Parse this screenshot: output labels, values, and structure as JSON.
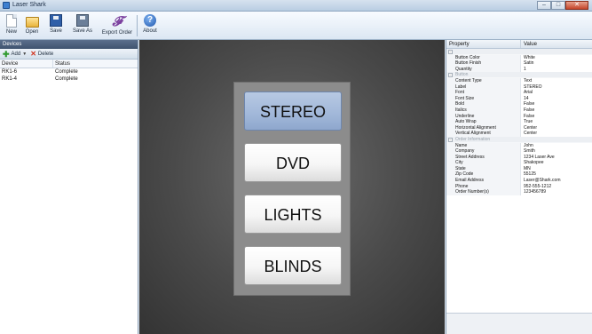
{
  "window": {
    "title": "Laser Shark",
    "controls": [
      "–",
      "□",
      "✕"
    ]
  },
  "toolbar": {
    "items": [
      {
        "label": "New",
        "icon": "new-document-icon"
      },
      {
        "label": "Open",
        "icon": "open-folder-icon"
      },
      {
        "label": "Save",
        "icon": "save-icon"
      },
      {
        "label": "Save As",
        "icon": "save-as-icon"
      },
      {
        "label": "Export Order",
        "icon": "export-order-icon"
      },
      {
        "label": "About",
        "icon": "about-icon"
      }
    ],
    "export_glyph": "𝓕",
    "about_glyph": "?"
  },
  "devices": {
    "header": "Devices",
    "add_label": "Add",
    "delete_label": "Delete",
    "columns": [
      "Device",
      "Status"
    ],
    "rows": [
      {
        "device": "RK1-6",
        "status": "Complete"
      },
      {
        "device": "RK1-4",
        "status": "Complete"
      }
    ]
  },
  "keypad": {
    "selected_index": 0,
    "buttons": [
      "STEREO",
      "DVD",
      "LIGHTS",
      "BLINDS"
    ]
  },
  "properties": {
    "columns": [
      "Property",
      "Value"
    ],
    "groups": [
      {
        "name": "",
        "rows": [
          {
            "p": "Button Color",
            "v": "White"
          },
          {
            "p": "Button Finish",
            "v": "Satin"
          },
          {
            "p": "Quantity",
            "v": "1"
          }
        ]
      },
      {
        "name": "Button",
        "rows": [
          {
            "p": "Content Type",
            "v": "Text"
          },
          {
            "p": "Label",
            "v": "STEREO"
          },
          {
            "p": "Font",
            "v": "Arial"
          },
          {
            "p": "Font Size",
            "v": "14"
          },
          {
            "p": "Bold",
            "v": "False"
          },
          {
            "p": "Italics",
            "v": "False"
          },
          {
            "p": "Underline",
            "v": "False"
          },
          {
            "p": "Auto Wrap",
            "v": "True"
          },
          {
            "p": "Horizontal Alignment",
            "v": "Center"
          },
          {
            "p": "Vertical Alignment",
            "v": "Center"
          }
        ]
      },
      {
        "name": "Order Information",
        "rows": [
          {
            "p": "Name",
            "v": "John"
          },
          {
            "p": "Company",
            "v": "Smith"
          },
          {
            "p": "Street Address",
            "v": "1234 Laser Ave"
          },
          {
            "p": "City",
            "v": "Shakopee"
          },
          {
            "p": "State",
            "v": "MN"
          },
          {
            "p": "Zip Code",
            "v": "55125"
          },
          {
            "p": "Email Address",
            "v": "Laser@Shark.com"
          },
          {
            "p": "Phone",
            "v": "952-555-1212"
          },
          {
            "p": "Order Number(s)",
            "v": "123456789"
          }
        ]
      }
    ]
  }
}
